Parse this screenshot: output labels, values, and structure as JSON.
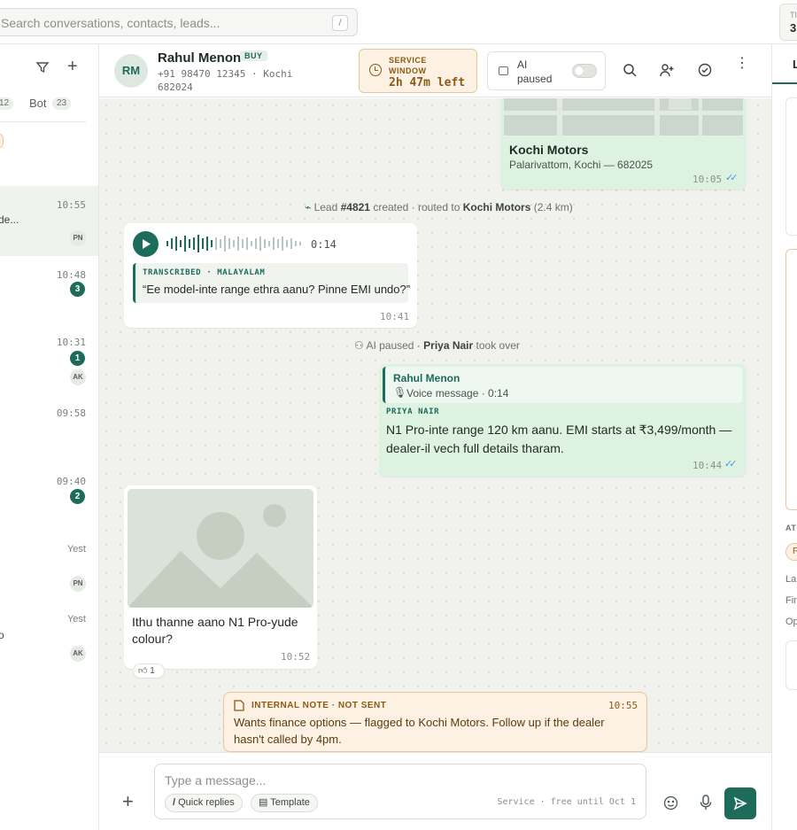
{
  "topbar": {
    "search_placeholder": "Search conversations, contacts, leads...",
    "search_shortcut": "/",
    "right_card_label": "TI",
    "right_card_value": "3"
  },
  "left_panel": {
    "tab_first_count": "12",
    "tab_bot_label": "Bot",
    "tab_bot_count": "23",
    "conversations": [
      {
        "time": "10:55",
        "snippet": "de...",
        "agent": "PN",
        "unread": ""
      },
      {
        "time": "10:48",
        "snippet": "",
        "agent": "",
        "unread": "3"
      },
      {
        "time": "10:31",
        "snippet": "",
        "agent": "AK",
        "unread": "1"
      },
      {
        "time": "09:58",
        "snippet": "",
        "agent": "",
        "unread": ""
      },
      {
        "time": "09:40",
        "snippet": "",
        "agent": "",
        "unread": "2"
      },
      {
        "time": "Yest",
        "snippet": "",
        "agent": "PN",
        "unread": ""
      },
      {
        "time": "Yest",
        "snippet": "o",
        "agent": "AK",
        "unread": ""
      }
    ]
  },
  "header": {
    "avatar_initials": "RM",
    "contact_name": "Rahul Menon",
    "intent_badge": "BUY",
    "phone_location": "+91 98470 12345 · Kochi 682024",
    "service_window_label": "SERVICE WINDOW",
    "service_window_value": "2h 47m left",
    "ai_status": "AI paused"
  },
  "messages": {
    "location": {
      "title": "Kochi Motors",
      "address": "Palarivattom, Kochi — 682025",
      "time": "10:05"
    },
    "lead_event": {
      "prefix": "Lead ",
      "lead_id": "#4821",
      "mid": " created · routed to ",
      "dealer": "Kochi Motors",
      "suffix": " (2.4 km)"
    },
    "voice": {
      "duration": "0:14",
      "transcribed_label": "TRANSCRIBED · MALAYALAM",
      "transcript": "“Ee model-inte range ethra aanu? Pinne EMI undo?”",
      "time": "10:41"
    },
    "ai_event": {
      "prefix": "AI paused · ",
      "agent": "Priya Nair",
      "suffix": " took over"
    },
    "reply": {
      "quote_author": "Rahul Menon",
      "quote_text": "Voice message · 0:14",
      "sender": "PRIYA NAIR",
      "text": "N1 Pro-inte range 120 km aanu. EMI starts at ₹3,499/month — dealer-il vech full details tharam.",
      "time": "10:44"
    },
    "image": {
      "caption": "Ithu thanne aano N1 Pro-yude colour?",
      "time": "10:52",
      "reaction_count": "1"
    },
    "note": {
      "label": "INTERNAL NOTE · NOT SENT",
      "time": "10:55",
      "text": "Wants finance options — flagged to Kochi Motors. Follow up if the dealer hasn't called by 4pm."
    }
  },
  "composer": {
    "placeholder": "Type a message...",
    "quick_replies": "Quick replies",
    "template": "Template",
    "hint": "Service · free until Oct 1"
  },
  "right_panel": {
    "tab_initial": "L",
    "section_label": "AT",
    "chip_initial": "F",
    "row1": "La",
    "row2": "Fir",
    "row3": "Op"
  },
  "colors": {
    "brand": "#1d6b5a",
    "outgoing_bubble": "#ddf2e1",
    "note_bg": "#fcf1e2",
    "read_ticks": "#4a9ad8"
  }
}
